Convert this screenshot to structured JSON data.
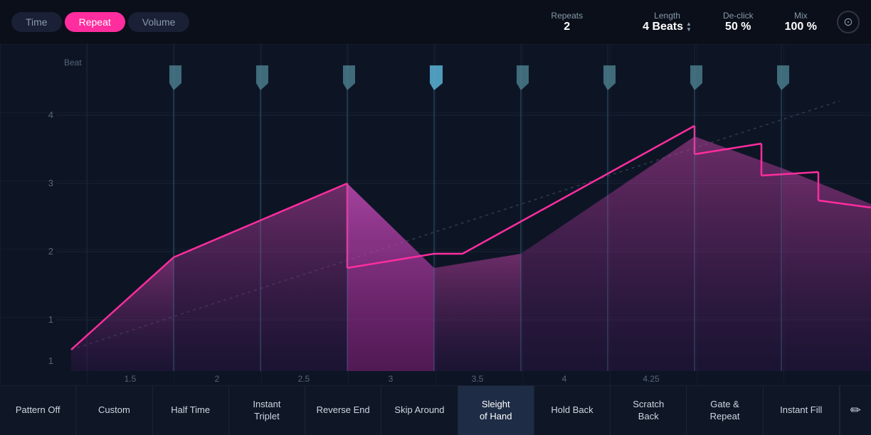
{
  "header": {
    "tabs": [
      "Time",
      "Repeat",
      "Volume"
    ],
    "active_tab": "Repeat",
    "repeats_label": "Repeats",
    "repeats_value": "2",
    "length_label": "Length",
    "length_value": "4 Beats",
    "declick_label": "De-click",
    "declick_value": "50 %",
    "mix_label": "Mix",
    "mix_value": "100 %"
  },
  "chart": {
    "beat_label": "Beat",
    "x_labels": [
      "1.5",
      "2",
      "2.5",
      "3",
      "3.5",
      "4",
      "4.25"
    ],
    "y_labels": [
      "1",
      "2",
      "3",
      "4"
    ]
  },
  "bottom": {
    "buttons": [
      {
        "label": "Pattern Off",
        "active": false
      },
      {
        "label": "Custom",
        "active": false
      },
      {
        "label": "Half Time",
        "active": false
      },
      {
        "label": "Instant Triplet",
        "active": false
      },
      {
        "label": "Reverse End",
        "active": false
      },
      {
        "label": "Skip Around",
        "active": false
      },
      {
        "label": "Sleight of Hand",
        "active": true
      },
      {
        "label": "Hold Back",
        "active": false
      },
      {
        "label": "Scratch Back",
        "active": false
      },
      {
        "label": "Gate & Repeat",
        "active": false
      },
      {
        "label": "Instant Fill",
        "active": false
      }
    ],
    "edit_icon": "✏"
  }
}
